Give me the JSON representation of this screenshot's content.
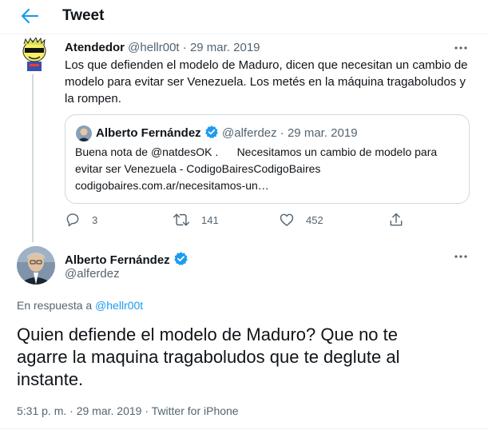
{
  "header": {
    "title": "Tweet"
  },
  "parent_tweet": {
    "author_name": "Atendedor",
    "author_handle": "@hellr00t",
    "separator": "·",
    "date": "29 mar. 2019",
    "text_lines": [
      "Los que defienden el modelo de Maduro, dicen que necesitan un cambio de",
      "modelo para evitar ser Venezuela. Los metés en la máquina tragaboludos y",
      "la rompen."
    ],
    "quote": {
      "author_name": "Alberto Fernández",
      "author_handle": "@alferdez",
      "separator": "·",
      "date": "29 mar. 2019",
      "text_lines": [
        "Buena nota de @natdesOK .      Necesitamos un cambio de modelo para",
        "evitar ser Venezuela - CodigoBairesCodigoBaires",
        "codigobaires.com.ar/necesitamos-un…"
      ]
    },
    "actions": {
      "replies": "3",
      "retweets": "141",
      "likes": "452"
    }
  },
  "main_tweet": {
    "author_name": "Alberto Fernández",
    "author_handle": "@alferdez",
    "reply_prefix": "En respuesta a",
    "reply_to": "@hellr00t",
    "text_lines": [
      "Quien defiende el modelo de Maduro? Que no te",
      "agarre la maquina tragaboludos que te deglute al",
      "instante."
    ],
    "meta": {
      "time": "5:31 p. m.",
      "separator1": "·",
      "date": "29 mar. 2019",
      "separator2": "·",
      "source": "Twitter for iPhone"
    }
  },
  "colors": {
    "accent": "#1d9bf0",
    "muted": "#536471",
    "border": "#cfd9de"
  },
  "icons": [
    "back-arrow-icon",
    "verified-badge-icon",
    "more-icon",
    "reply-icon",
    "retweet-icon",
    "like-icon",
    "share-icon"
  ]
}
